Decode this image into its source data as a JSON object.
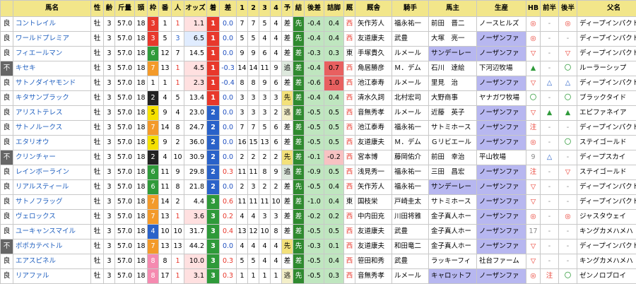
{
  "headers": [
    "",
    "馬名",
    "性",
    "齢",
    "斤量",
    "頭",
    "枠",
    "番",
    "人",
    "オッズ",
    "着",
    "差",
    "1",
    "2",
    "3",
    "4",
    "予",
    "結",
    "後差",
    "詰脚",
    "厩",
    "厩舎",
    "騎手",
    "馬主",
    "生産",
    "HB",
    "前半",
    "後半",
    "父名",
    "開隅"
  ],
  "rows": [
    {
      "ground": "良",
      "name": "コントレイル",
      "sex": "牡",
      "age": "3",
      "wt": "57.0",
      "tou": "18",
      "waku": "3",
      "ban": "1",
      "pop": "1",
      "odds": "1.1",
      "chaku": "1",
      "sa": "0.0",
      "c1": "7",
      "c2": "7",
      "c3": "5",
      "c4": "4",
      "yo": "差",
      "ke": "先",
      "atosa": "-0.4",
      "tsume": "0.4",
      "kyu": "西",
      "kyusha": "矢作芳人",
      "jockey": "福永祐一",
      "owner": "前田　晋二",
      "breeder": "ノースヒルズ",
      "hb": "◎",
      "zen": "-",
      "kou": "◎",
      "sire": "ディープインパクト",
      "kai": "3"
    },
    {
      "ground": "良",
      "name": "ワールドプレミア",
      "sex": "牡",
      "age": "3",
      "wt": "57.0",
      "tou": "18",
      "waku": "3",
      "ban": "5",
      "pop": "3",
      "odds": "6.5",
      "chaku": "1",
      "sa": "0.0",
      "c1": "5",
      "c2": "5",
      "c3": "4",
      "c4": "4",
      "yo": "差",
      "ke": "先",
      "atosa": "-0.4",
      "tsume": "0.4",
      "kyu": "西",
      "kyusha": "友道康夫",
      "jockey": "武豊",
      "owner": "大塚　亮一",
      "breeder": "ノーザンファ",
      "hb": "◎",
      "zen": "-",
      "kou": "-",
      "sire": "ディープインパクト",
      "kai": "3"
    },
    {
      "ground": "良",
      "name": "フィエールマン",
      "sex": "牡",
      "age": "3",
      "wt": "57.0",
      "tou": "18",
      "waku": "6",
      "ban": "12",
      "pop": "7",
      "odds": "14.5",
      "chaku": "1",
      "sa": "0.0",
      "c1": "9",
      "c2": "9",
      "c3": "6",
      "c4": "4",
      "yo": "差",
      "ke": "差",
      "atosa": "-0.3",
      "tsume": "0.3",
      "kyu": "東",
      "kyusha": "手塚貴久",
      "jockey": "ルメール",
      "owner": "サンデーレー",
      "breeder": "ノーザンファ",
      "hb": "▽",
      "zen": "-",
      "kou": "▽",
      "sire": "ディープインパクト",
      "kai": "15"
    },
    {
      "ground": "不",
      "name": "キセキ",
      "sex": "牡",
      "age": "3",
      "wt": "57.0",
      "tou": "18",
      "waku": "7",
      "ban": "13",
      "pop": "1",
      "odds": "4.5",
      "chaku": "1",
      "sa": "-0.3",
      "c1": "14",
      "c2": "14",
      "c3": "11",
      "c4": "9",
      "yo": "追",
      "ke": "差",
      "atosa": "-0.4",
      "tsume": "0.7",
      "kyu": "西",
      "kyusha": "角居勝彦",
      "jockey": "Ｍ．デム",
      "owner": "石川　達絵",
      "breeder": "下河辺牧場",
      "hb": "▲",
      "zen": "-",
      "kou": "〇",
      "sire": "ルーラーシップ",
      "kai": "3"
    },
    {
      "ground": "良",
      "name": "サトノダイヤモンド",
      "sex": "牡",
      "age": "3",
      "wt": "57.0",
      "tou": "18",
      "waku": "1",
      "ban": "1",
      "pop": "1",
      "odds": "2.3",
      "chaku": "1",
      "sa": "-0.4",
      "c1": "8",
      "c2": "8",
      "c3": "9",
      "c4": "6",
      "yo": "差",
      "ke": "差",
      "atosa": "-0.6",
      "tsume": "1.0",
      "kyu": "西",
      "kyusha": "池江泰寿",
      "jockey": "ルメール",
      "owner": "里見　治",
      "breeder": "ノーザンファ",
      "hb": "▽",
      "zen": "△",
      "kou": "△",
      "sire": "ディープインパクト",
      "kai": "3"
    },
    {
      "ground": "良",
      "name": "キタサンブラック",
      "sex": "牡",
      "age": "3",
      "wt": "57.0",
      "tou": "18",
      "waku": "2",
      "ban": "4",
      "pop": "5",
      "odds": "13.4",
      "chaku": "1",
      "sa": "0.0",
      "c1": "3",
      "c2": "3",
      "c3": "3",
      "c4": "3",
      "yo": "先",
      "ke": "差",
      "atosa": "-0.4",
      "tsume": "0.4",
      "kyu": "西",
      "kyusha": "清水久詞",
      "jockey": "北村宏司",
      "owner": "大野商事",
      "breeder": "ヤナガワ牧場",
      "hb": "〇",
      "zen": "-",
      "kou": "〇",
      "sire": "ブラックタイド",
      "kai": "4"
    },
    {
      "ground": "良",
      "name": "アリストテレス",
      "sex": "牡",
      "age": "3",
      "wt": "57.0",
      "tou": "18",
      "waku": "5",
      "ban": "9",
      "pop": "4",
      "odds": "23.0",
      "chaku": "2",
      "sa": "0.0",
      "c1": "3",
      "c2": "3",
      "c3": "3",
      "c4": "2",
      "yo": "逃",
      "ke": "差",
      "atosa": "-0.5",
      "tsume": "0.5",
      "kyu": "西",
      "kyusha": "音無秀孝",
      "jockey": "ルメール",
      "owner": "近藤　英子",
      "breeder": "ノーザンファ",
      "hb": "▽",
      "zen": "▲",
      "kou": "▲",
      "sire": "エピファネイア",
      "kai": "4"
    },
    {
      "ground": "良",
      "name": "サトノルークス",
      "sex": "牡",
      "age": "3",
      "wt": "57.0",
      "tou": "18",
      "waku": "7",
      "ban": "14",
      "pop": "8",
      "odds": "24.7",
      "chaku": "2",
      "sa": "0.0",
      "c1": "7",
      "c2": "7",
      "c3": "5",
      "c4": "6",
      "yo": "差",
      "ke": "差",
      "atosa": "-0.5",
      "tsume": "0.5",
      "kyu": "西",
      "kyusha": "池江泰寿",
      "jockey": "福永祐一",
      "owner": "サトミホース",
      "breeder": "ノーザンファ",
      "hb": "注",
      "zen": "-",
      "kou": "-",
      "sire": "ディープインパクト",
      "kai": "3"
    },
    {
      "ground": "良",
      "name": "エタリオウ",
      "sex": "牡",
      "age": "3",
      "wt": "57.0",
      "tou": "18",
      "waku": "5",
      "ban": "9",
      "pop": "2",
      "odds": "36.0",
      "chaku": "2",
      "sa": "0.0",
      "c1": "16",
      "c2": "15",
      "c3": "13",
      "c4": "6",
      "yo": "差",
      "ke": "差",
      "atosa": "-0.5",
      "tsume": "0.5",
      "kyu": "西",
      "kyusha": "友道康夫",
      "jockey": "Ｍ．デム",
      "owner": "Ｇリビエール",
      "breeder": "ノーザンファ",
      "hb": "◎",
      "zen": "-",
      "kou": "〇",
      "sire": "ステイゴールド",
      "kai": "3"
    },
    {
      "ground": "不",
      "name": "クリンチャー",
      "sex": "牡",
      "age": "3",
      "wt": "57.0",
      "tou": "18",
      "waku": "2",
      "ban": "4",
      "pop": "10",
      "odds": "30.9",
      "chaku": "2",
      "sa": "0.0",
      "c1": "2",
      "c2": "2",
      "c3": "2",
      "c4": "2",
      "yo": "先",
      "ke": "差",
      "atosa": "-0.1",
      "tsume": "-0.2",
      "kyu": "西",
      "kyusha": "宮本博",
      "jockey": "藤岡佑介",
      "owner": "前田　幸治",
      "breeder": "平山牧場",
      "hb": "9",
      "zen": "△",
      "kou": "-",
      "sire": "ディープスカイ",
      "kai": "4"
    },
    {
      "ground": "良",
      "name": "レインボーライン",
      "sex": "牡",
      "age": "3",
      "wt": "57.0",
      "tou": "18",
      "waku": "6",
      "ban": "11",
      "pop": "9",
      "odds": "29.8",
      "chaku": "2",
      "sa": "0.3",
      "c1": "11",
      "c2": "11",
      "c3": "8",
      "c4": "9",
      "yo": "追",
      "ke": "差",
      "atosa": "-0.9",
      "tsume": "0.5",
      "kyu": "西",
      "kyusha": "浅見秀一",
      "jockey": "福永祐一",
      "owner": "三田　昌宏",
      "breeder": "ノーザンファ",
      "hb": "注",
      "zen": "-",
      "kou": "▽",
      "sire": "ステイゴールド",
      "kai": "3"
    },
    {
      "ground": "良",
      "name": "リアルスティール",
      "sex": "牡",
      "age": "3",
      "wt": "57.0",
      "tou": "18",
      "waku": "6",
      "ban": "11",
      "pop": "8",
      "odds": "21.8",
      "chaku": "2",
      "sa": "0.0",
      "c1": "2",
      "c2": "3",
      "c3": "2",
      "c4": "2",
      "yo": "差",
      "ke": "先",
      "atosa": "-0.5",
      "tsume": "0.4",
      "kyu": "西",
      "kyusha": "矢作芳人",
      "jockey": "福永祐一",
      "owner": "サンデーレー",
      "breeder": "ノーザンファ",
      "hb": "▽",
      "zen": "-",
      "kou": "-",
      "sire": "ディープインパクト",
      "kai": "3"
    },
    {
      "ground": "良",
      "name": "サトノフラッグ",
      "sex": "牡",
      "age": "3",
      "wt": "57.0",
      "tou": "18",
      "waku": "7",
      "ban": "14",
      "pop": "2",
      "odds": "4.4",
      "chaku": "3",
      "sa": "0.6",
      "c1": "11",
      "c2": "11",
      "c3": "11",
      "c4": "10",
      "yo": "差",
      "ke": "差",
      "atosa": "-1.0",
      "tsume": "0.4",
      "kyu": "東",
      "kyusha": "国枝栄",
      "jockey": "戸崎圭太",
      "owner": "サトミホース",
      "breeder": "ノーザンファ",
      "hb": "▽",
      "zen": "-",
      "kou": "-",
      "sire": "ディープインパクト",
      "kai": "3"
    },
    {
      "ground": "良",
      "name": "ヴェロックス",
      "sex": "牡",
      "age": "3",
      "wt": "57.0",
      "tou": "18",
      "waku": "7",
      "ban": "13",
      "pop": "1",
      "odds": "3.6",
      "chaku": "3",
      "sa": "0.2",
      "c1": "4",
      "c2": "4",
      "c3": "3",
      "c4": "3",
      "yo": "差",
      "ke": "差",
      "atosa": "-0.2",
      "tsume": "0.2",
      "kyu": "西",
      "kyusha": "中内田充",
      "jockey": "川田将雅",
      "owner": "金子真人ホー",
      "breeder": "ノーザンファ",
      "hb": "◎",
      "zen": "-",
      "kou": "◎",
      "sire": "ジャスタウェイ",
      "kai": "3"
    },
    {
      "ground": "良",
      "name": "ユーキャンスマイル",
      "sex": "牡",
      "age": "3",
      "wt": "57.0",
      "tou": "18",
      "waku": "4",
      "ban": "10",
      "pop": "10",
      "odds": "31.7",
      "chaku": "3",
      "sa": "0.4",
      "c1": "13",
      "c2": "12",
      "c3": "10",
      "c4": "8",
      "yo": "差",
      "ke": "差",
      "atosa": "-0.5",
      "tsume": "0.5",
      "kyu": "西",
      "kyusha": "友道康夫",
      "jockey": "武豊",
      "owner": "金子真人ホー",
      "breeder": "ノーザンファ",
      "hb": "17",
      "zen": "-",
      "kou": "-",
      "sire": "キングカメハメハ",
      "kai": "3"
    },
    {
      "ground": "不",
      "name": "ポポカテペトル",
      "sex": "牡",
      "age": "3",
      "wt": "57.0",
      "tou": "18",
      "waku": "7",
      "ban": "13",
      "pop": "13",
      "odds": "44.2",
      "chaku": "3",
      "sa": "0.0",
      "c1": "4",
      "c2": "4",
      "c3": "4",
      "c4": "4",
      "yo": "先",
      "ke": "先",
      "atosa": "-0.3",
      "tsume": "0.1",
      "kyu": "西",
      "kyusha": "友道康夫",
      "jockey": "和田竜二",
      "owner": "金子真人ホー",
      "breeder": "ノーザンファ",
      "hb": "▽",
      "zen": "-",
      "kou": "-",
      "sire": "ディープインパクト",
      "kai": "3"
    },
    {
      "ground": "良",
      "name": "エアスピネル",
      "sex": "牡",
      "age": "3",
      "wt": "57.0",
      "tou": "18",
      "waku": "8",
      "ban": "8",
      "pop": "1",
      "odds": "10.0",
      "chaku": "3",
      "sa": "0.3",
      "c1": "5",
      "c2": "5",
      "c3": "4",
      "c4": "4",
      "yo": "差",
      "ke": "差",
      "atosa": "-0.5",
      "tsume": "0.4",
      "kyu": "西",
      "kyusha": "笹田和秀",
      "jockey": "武豊",
      "owner": "ラッキーフィ",
      "breeder": "社台ファーム",
      "hb": "▽",
      "zen": "-",
      "kou": "-",
      "sire": "キングカメハメハ",
      "kai": "3"
    },
    {
      "ground": "良",
      "name": "リアファル",
      "sex": "牡",
      "age": "3",
      "wt": "57.0",
      "tou": "18",
      "waku": "8",
      "ban": "17",
      "pop": "1",
      "odds": "3.1",
      "chaku": "3",
      "sa": "0.3",
      "c1": "1",
      "c2": "1",
      "c3": "1",
      "c4": "1",
      "yo": "逃",
      "ke": "先",
      "atosa": "-0.5",
      "tsume": "0.3",
      "kyu": "西",
      "kyusha": "音無秀孝",
      "jockey": "ルメール",
      "owner": "キャロットフ",
      "breeder": "ノーザンファ",
      "hb": "◎",
      "zen": "注",
      "kou": "〇",
      "sire": "ゼンノロブロイ",
      "kai": "3"
    }
  ]
}
